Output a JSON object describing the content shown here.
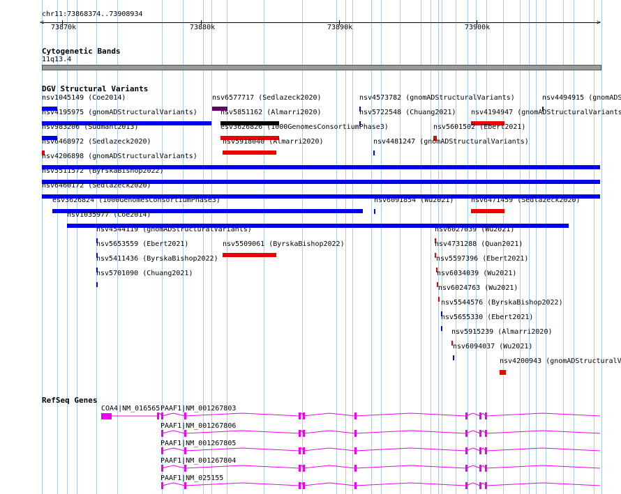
{
  "ruler": {
    "locus": "chr11:73868374..73908934",
    "ticks": [
      "73870k",
      "73880k",
      "73890k",
      "73900k"
    ]
  },
  "cyto": {
    "title": "Cytogenetic Bands",
    "band": "11q13.4"
  },
  "dgv": {
    "title": "DGV Structural Variants",
    "colors": {
      "blue": "#0000ee",
      "red": "#ee0000",
      "black": "#000000",
      "purple": "#660066"
    },
    "features": [
      {
        "label": "nsv1045149 (Coe2014)",
        "color": "blue"
      },
      {
        "label": "nsv6577717 (Sedlazeck2020)",
        "color": "purple"
      },
      {
        "label": "nsv4573782 (gnomADStructuralVariants)",
        "color": "blue"
      },
      {
        "label": "nsv4494915 (gnomADS",
        "color": "blue"
      },
      {
        "label": "nsv4195975 (gnomADStructuralVariants)",
        "color": "blue"
      },
      {
        "label": "nsv5851162 (Almarri2020)",
        "color": "black"
      },
      {
        "label": "nsv5722548 (Chuang2021)",
        "color": "blue"
      },
      {
        "label": "nsv4194947 (gnomADStructuralVariants)",
        "color": "red"
      },
      {
        "label": "nsv983206 (Sudmant2013)",
        "color": "blue"
      },
      {
        "label": "esv3626826 (1000GenomesConsortiumPhase3)",
        "color": "red"
      },
      {
        "label": "nsv5601502 (Ebert2021)",
        "color": "red"
      },
      {
        "label": "nsv6468972 (Sedlazeck2020)",
        "color": "red"
      },
      {
        "label": "nsv5918040 (Almarri2020)",
        "color": "red"
      },
      {
        "label": "nsv4481247 (gnomADStructuralVariants)",
        "color": "blue"
      },
      {
        "label": "nsv4206898 (gnomADStructuralVariants)",
        "color": "blue"
      },
      {
        "label": "nsv5511572 (ByrskaBishop2022)",
        "color": "blue"
      },
      {
        "label": "nsv6460172 (Sedlazeck2020)",
        "color": "blue"
      },
      {
        "label": "esv3626824 (1000GenomesConsortiumPhase3)",
        "color": "blue"
      },
      {
        "label": "nsv6091854 (Wu2021)",
        "color": "blue"
      },
      {
        "label": "nsv6471459 (Sedlazeck2020)",
        "color": "red"
      },
      {
        "label": "nsv1035977 (Coe2014)",
        "color": "blue"
      },
      {
        "label": "nsv4544119 (gnomADStructuralVariants)",
        "color": "blue"
      },
      {
        "label": "nsv6027039 (Wu2021)",
        "color": "red"
      },
      {
        "label": "nsv5653559 (Ebert2021)",
        "color": "blue"
      },
      {
        "label": "nsv5509061 (ByrskaBishop2022)",
        "color": "red"
      },
      {
        "label": "nsv4731288 (Quan2021)",
        "color": "red"
      },
      {
        "label": "nsv5411436 (ByrskaBishop2022)",
        "color": "blue"
      },
      {
        "label": "nsv5597396 (Ebert2021)",
        "color": "red"
      },
      {
        "label": "nsv5701090 (Chuang2021)",
        "color": "blue"
      },
      {
        "label": "nsv6034039 (Wu2021)",
        "color": "red"
      },
      {
        "label": "nsv6024763 (Wu2021)",
        "color": "red"
      },
      {
        "label": "nsv5544576 (ByrskaBishop2022)",
        "color": "blue"
      },
      {
        "label": "nsv5655330 (Ebert2021)",
        "color": "blue"
      },
      {
        "label": "nsv5915239 (Almarri2020)",
        "color": "red"
      },
      {
        "label": "nsv6094037 (Wu2021)",
        "color": "blue"
      },
      {
        "label": "nsv4200943 (gnomADStructuralV",
        "color": "red"
      }
    ]
  },
  "refseq": {
    "title": "RefSeq Genes",
    "color": "#ee00ee",
    "genes": [
      {
        "label": "COA4|NM_016565"
      },
      {
        "label": "PAAF1|NM_001267803"
      },
      {
        "label": "PAAF1|NM_001267806"
      },
      {
        "label": "PAAF1|NM_001267805"
      },
      {
        "label": "PAAF1|NM_001267804"
      },
      {
        "label": "PAAF1|NM_025155"
      }
    ]
  }
}
